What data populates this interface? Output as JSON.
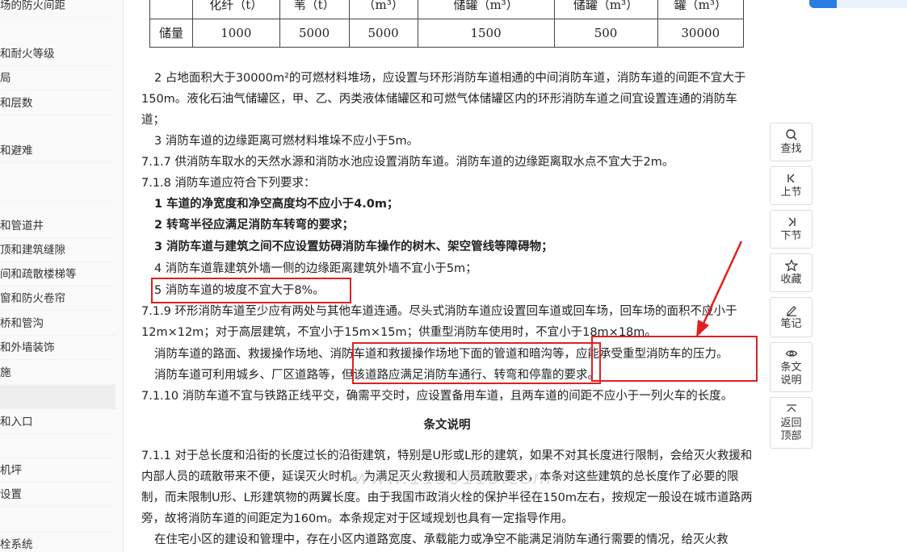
{
  "sidebar": {
    "items": [
      "场的防火间距",
      "和耐火等级",
      "局",
      "和层数",
      "和避难",
      "",
      "和管道井",
      "顶和建筑缝隙",
      "间和疏散楼梯等",
      "窗和防火卷帘",
      "桥和管沟",
      "和外墙装饰",
      "施",
      "",
      "和入口",
      "",
      "机坪",
      "设置",
      "",
      "栓系统"
    ]
  },
  "table": {
    "header": [
      "",
      "化纤（t）",
      "苇（t）",
      "（m³）",
      "储罐（m³）",
      "储罐（m³）",
      "罐（m³）"
    ],
    "row": [
      "储量",
      "1000",
      "5000",
      "5000",
      "1500",
      "500",
      "30000"
    ]
  },
  "content": {
    "p1": "2 占地面积大于30000m²的可燃材料堆场，应设置与环形消防车道相通的中间消防车道，消防车道的间距不宜大于150m。液化石油气储罐区，甲、乙、丙类液体储罐区和可燃气体储罐区内的环形消防车道之间宜设置连通的消防车道；",
    "p2": "3 消防车道的边缘距离可燃材料堆垛不应小于5m。",
    "p3": "7.1.7 供消防车取水的天然水源和消防水池应设置消防车道。消防车道的边缘距离取水点不宜大于2m。",
    "p4": "7.1.8 消防车道应符合下列要求：",
    "p5": "1 车道的净宽度和净空高度均不应小于4.0m；",
    "p6": "2 转弯半径应满足消防车转弯的要求；",
    "p7": "3 消防车道与建筑之间不应设置妨碍消防车操作的树木、架空管线等障碍物；",
    "p8": "4 消防车道靠建筑外墙一侧的边缘距离建筑外墙不宜小于5m；",
    "p9": "5 消防车道的坡度不宜大于8%。",
    "p10": "7.1.9 环形消防车道至少应有两处与其他车道连通。尽头式消防车道应设置回车道或回车场，回车场的面积不应小于12m×12m；对于高层建筑，不宜小于15m×15m；供重型消防车使用时，不宜小于18m×18m。",
    "p11": "消防车道的路面、救援操作场地、消防车道和救援操作场地下面的管道和暗沟等，应能承受重型消防车的压力。",
    "p12": "消防车道可利用城乡、厂区道路等，但该道路应满足消防车通行、转弯和停靠的要求。",
    "p13": "7.1.10 消防车道不宜与铁路正线平交，确需平交时，应设置备用车道，且两车道的间距不应小于一列火车的长度。",
    "heading": "条文说明",
    "p14": "7.1.1 对于总长度和沿街的长度过长的沿街建筑，特别是U形或L形的建筑，如果不对其长度进行限制，会给灭火救援和内部人员的疏散带来不便，延误灭火时机。为满足灭火救援和人员疏散要求，本条对这些建筑的总长度作了必要的限制，而未限制U形、L形建筑物的两翼长度。由于我国市政消火栓的保护半径在150m左右，按规定一般设在城市道路两旁，故将消防车道的间距定为160m。本条规定对于区域规划也具有一定指导作用。",
    "p15": "在住宅小区的建设和管理中，存在小区内道路宽度、承载能力或净空不能满足消防车通行需要的情况，给灭火救"
  },
  "watermark": "www.1190119.com",
  "toolbar": {
    "search": "查找",
    "prev": "上节",
    "next": "下节",
    "fav": "收藏",
    "note": "笔记",
    "explain": "条文说明",
    "top": "返回顶部"
  },
  "colors": {
    "annotation_red": "#e02020",
    "accent_blue": "#2a7de1"
  }
}
